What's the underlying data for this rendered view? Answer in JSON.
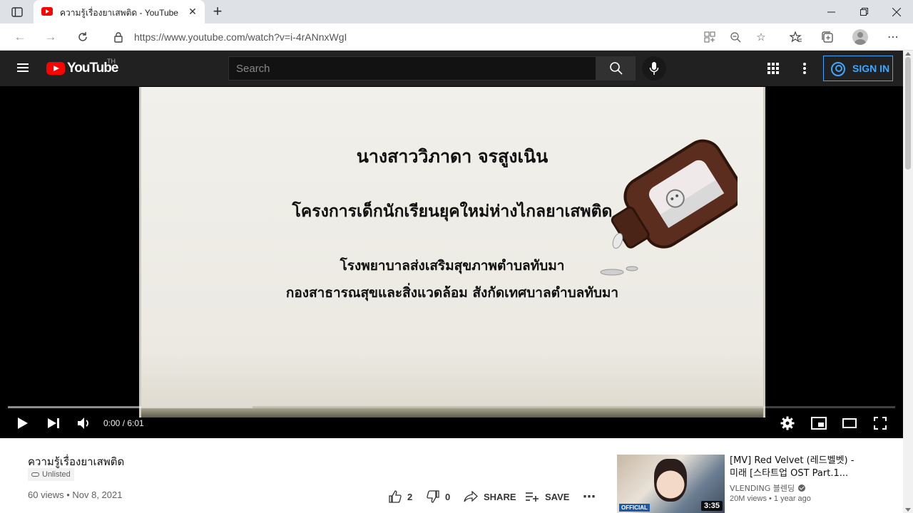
{
  "browser": {
    "tab_title": "ความรู้เรื่องยาเสพติด - YouTube",
    "url": "https://www.youtube.com/watch?v=i-4rANnxWgI"
  },
  "header": {
    "logo_text": "YouTube",
    "region": "TH",
    "search_placeholder": "Search",
    "signin_label": "SIGN IN"
  },
  "player": {
    "slide_lines": [
      "นางสาววิภาดา จรสูงเนิน",
      "โครงการเด็กนักเรียนยุคใหม่ห่างไกลยาเสพติด",
      "โรงพยาบาลส่งเสริมสุขภาพตำบลทับมา",
      "กองสาธารณสุขและสิ่งแวดล้อม  สังกัดเทศบาลตำบลทับมา"
    ],
    "time": "0:00 / 6:01",
    "buffered_fraction": 0.276
  },
  "video": {
    "title": "ความรู้เรื่องยาเสพติด",
    "badge": "Unlisted",
    "meta": "60 views • Nov 8, 2021",
    "likes": "2",
    "dislikes": "0",
    "share_label": "SHARE",
    "save_label": "SAVE"
  },
  "recommended": {
    "title": "[MV] Red Velvet (레드벨벳) - 미래 [스타트업 OST Part.1...",
    "channel": "VLENDING 블렌딩",
    "meta": "20M views • 1 year ago",
    "duration": "3:35",
    "thumb_tag": "OFFICIAL"
  },
  "colors": {
    "accent_blue": "#3ea6ff",
    "yt_red": "#ff0000",
    "header_bg": "#212121"
  }
}
